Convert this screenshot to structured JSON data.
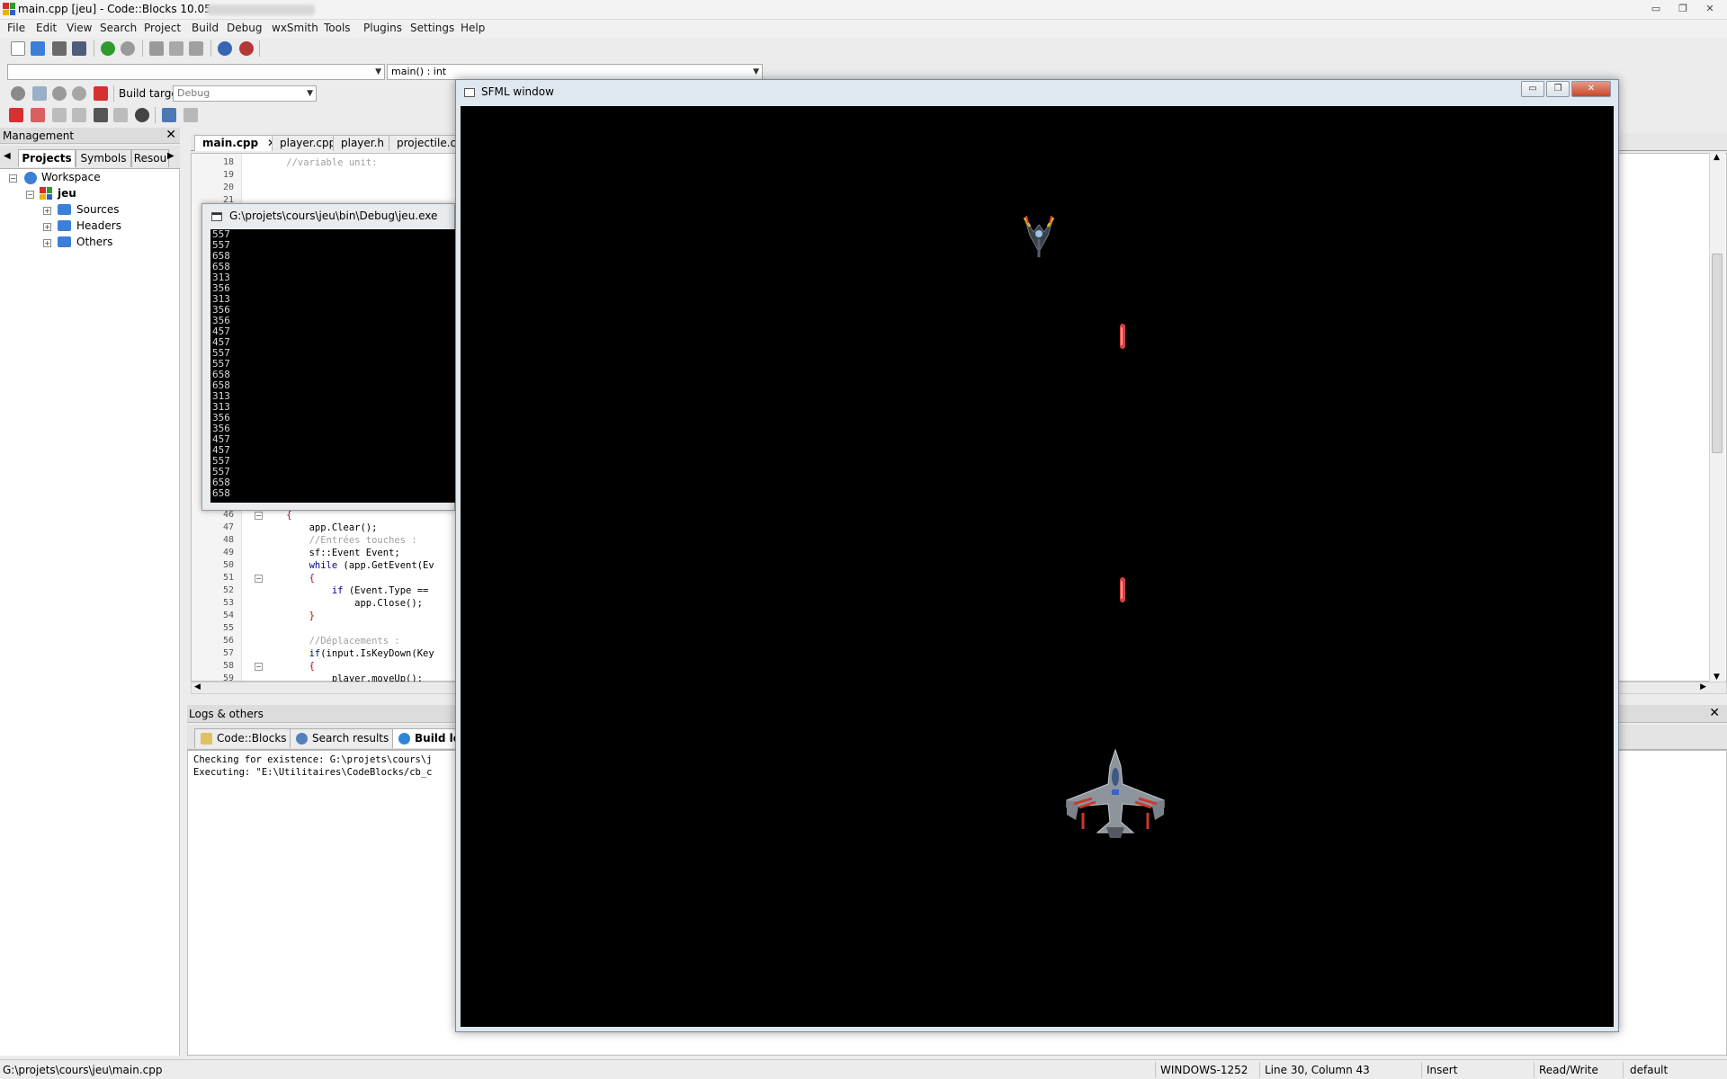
{
  "window": {
    "title": "main.cpp [jeu] - Code::Blocks 10.05",
    "controls": [
      "▭",
      "❐",
      "✕"
    ]
  },
  "menu": [
    "File",
    "Edit",
    "View",
    "Search",
    "Project",
    "Build",
    "Debug",
    "wxSmith",
    "Tools",
    "Plugins",
    "Settings",
    "Help"
  ],
  "toolbar": {
    "scope_combo": "",
    "function_combo": "main() : int",
    "build_target_label": "Build target:",
    "build_target_value": "Debug"
  },
  "management": {
    "title": "Management",
    "close": "✕",
    "tabs": [
      "Projects",
      "Symbols",
      "Resou"
    ],
    "active_tab": "Projects",
    "tree": {
      "workspace": "Workspace",
      "project": "jeu",
      "folders": [
        "Sources",
        "Headers",
        "Others"
      ]
    }
  },
  "editor": {
    "tabs": [
      "main.cpp",
      "player.cpp",
      "player.h",
      "projectile.cp"
    ],
    "active_tab": "main.cpp",
    "tab_close": "✕",
    "top_lines": [
      {
        "n": "18",
        "code": "    //variable unit:"
      },
      {
        "n": "19",
        "code": ""
      },
      {
        "n": "20",
        "code": ""
      },
      {
        "n": "21",
        "code": ""
      }
    ],
    "bottom_lines": [
      {
        "n": "46",
        "code": "    {"
      },
      {
        "n": "47",
        "code": "        app.Clear();"
      },
      {
        "n": "48",
        "code": "        //Entrées touches :"
      },
      {
        "n": "49",
        "code": "        sf::Event Event;"
      },
      {
        "n": "50",
        "code": "        while (app.GetEvent(Ev"
      },
      {
        "n": "51",
        "code": "        {"
      },
      {
        "n": "52",
        "code": "            if (Event.Type =="
      },
      {
        "n": "53",
        "code": "                app.Close();"
      },
      {
        "n": "54",
        "code": "        }"
      },
      {
        "n": "55",
        "code": ""
      },
      {
        "n": "56",
        "code": "        //Déplacements :"
      },
      {
        "n": "57",
        "code": "        if(input.IsKeyDown(Key"
      },
      {
        "n": "58",
        "code": "        {"
      },
      {
        "n": "59",
        "code": "            player.moveUp();"
      }
    ]
  },
  "console": {
    "title": "G:\\projets\\cours\\jeu\\bin\\Debug\\jeu.exe",
    "lines": [
      "557",
      "557",
      "658",
      "658",
      "313",
      "356",
      "313",
      "356",
      "356",
      "457",
      "457",
      "557",
      "557",
      "658",
      "658",
      "313",
      "313",
      "356",
      "356",
      "457",
      "457",
      "557",
      "557",
      "658",
      "658"
    ]
  },
  "sfml": {
    "title": "SFML window",
    "controls": [
      "▭",
      "❐",
      "✕"
    ]
  },
  "logs": {
    "title": "Logs & others",
    "close": "✕",
    "tabs": [
      "Code::Blocks",
      "Search results",
      "Build log"
    ],
    "active_tab": "Build log",
    "lines": [
      "Checking for existence: G:\\projets\\cours\\j",
      "Executing: \"E:\\Utilitaires\\CodeBlocks/cb_c"
    ]
  },
  "status": {
    "path": "G:\\projets\\cours\\jeu\\main.cpp",
    "encoding": "WINDOWS-1252",
    "position": "Line 30, Column 43",
    "mode": "Insert",
    "access": "Read/Write",
    "profile": "default"
  },
  "colors": {
    "keyword": "#00008b",
    "comment": "#a0a0a0",
    "operator": "#d00000",
    "console_bg": "#000000",
    "game_bg": "#000000",
    "projectile": "#e04a4a"
  }
}
